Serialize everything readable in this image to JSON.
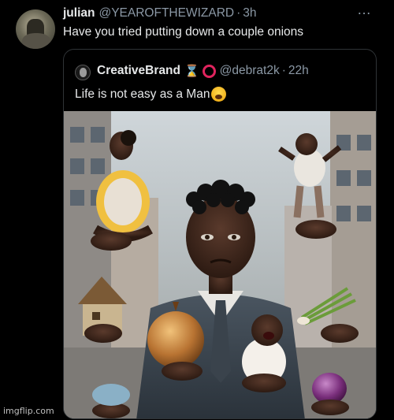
{
  "tweet": {
    "display_name": "julian",
    "handle": "@YEAROFTHEWIZARD",
    "separator": "·",
    "time": "3h",
    "more_icon": "…",
    "text": "Have you tried putting down a couple onions"
  },
  "quoted_tweet": {
    "display_name": "CreativeBrand",
    "hourglass_icon": "⌛",
    "handle": "@debrat2k",
    "separator": "·",
    "time": "22h",
    "text": "Life is not easy as a Man"
  },
  "watermark": "imgflip.com"
}
